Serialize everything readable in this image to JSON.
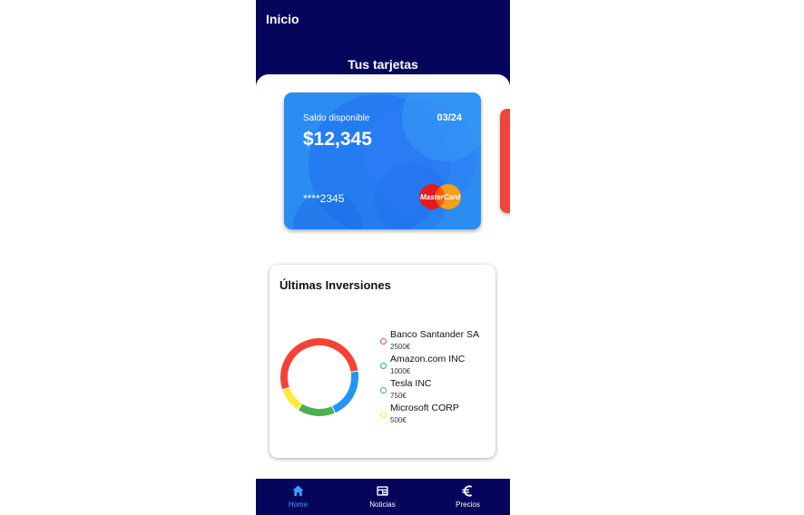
{
  "appbar": {
    "title": "Inicio"
  },
  "cards_section": {
    "title": "Tus tarjetas"
  },
  "card": {
    "label": "Saldo disponible",
    "expiry": "03/24",
    "balance": "$12,345",
    "number": "****2345",
    "brand": "MasterCard"
  },
  "investments": {
    "title": "Últimas Inversiones",
    "items": [
      {
        "name": "Banco Santander SA",
        "value": "2500€",
        "color": "#f44336"
      },
      {
        "name": "Amazon.com INC",
        "value": "1000€",
        "color": "#2196f3"
      },
      {
        "name": "Tesla INC",
        "value": "750€",
        "color": "#4caf50"
      },
      {
        "name": "Microsoft CORP",
        "value": "500€",
        "color": "#ffeb3b"
      }
    ],
    "chart_values": [
      2500,
      1000,
      750,
      500
    ]
  },
  "nav": {
    "items": [
      {
        "label": "Home",
        "icon": "home-icon",
        "active": true
      },
      {
        "label": "Noticias",
        "icon": "news-icon",
        "active": false
      },
      {
        "label": "Precios",
        "icon": "euro-icon",
        "active": false
      }
    ]
  },
  "colors": {
    "primary": "#05055c",
    "card": "#2b8cf2",
    "active_nav": "#3b9cff"
  }
}
